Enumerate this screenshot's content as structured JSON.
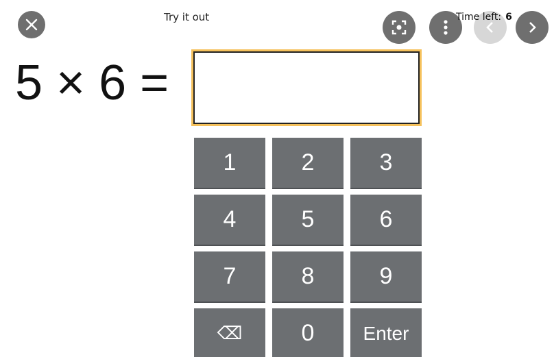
{
  "header": {
    "title": "Try it out",
    "timer_label": "Time left:",
    "timer_value": "6"
  },
  "icons": {
    "close": "close-icon",
    "lens": "lens-icon",
    "menu": "more-vert-icon",
    "prev": "chevron-left-icon",
    "next": "chevron-right-icon",
    "backspace": "backspace-icon"
  },
  "equation": {
    "text": "5 × 6 ="
  },
  "answer": {
    "value": "",
    "accent_color": "#f5c15c"
  },
  "keypad": {
    "keys": [
      "1",
      "2",
      "3",
      "4",
      "5",
      "6",
      "7",
      "8",
      "9",
      "⌫",
      "0",
      "Enter"
    ]
  },
  "colors": {
    "key_bg": "#6c6f72",
    "button_bg": "#6f6f6f"
  }
}
